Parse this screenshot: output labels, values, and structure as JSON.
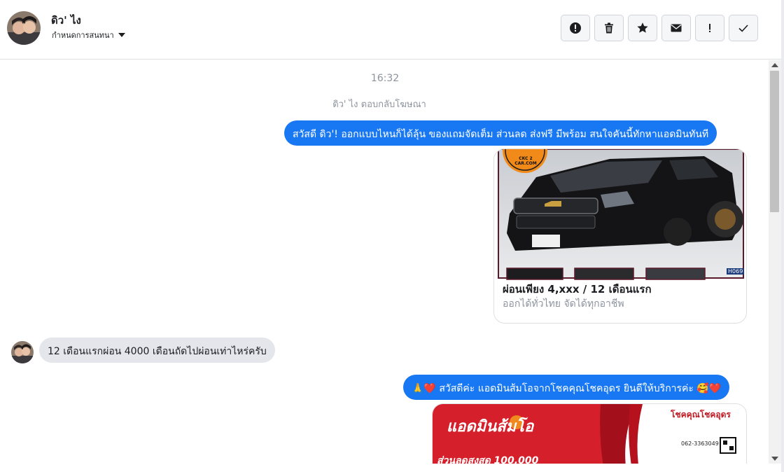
{
  "header": {
    "contact_name": "ดิว' ไง",
    "assign_label": "กำหนดการสนทนา"
  },
  "toolbar": {
    "buttons": [
      {
        "name": "spam-icon",
        "label": "report"
      },
      {
        "name": "trash-icon",
        "label": "delete"
      },
      {
        "name": "star-icon",
        "label": "star"
      },
      {
        "name": "envelope-icon",
        "label": "unread"
      },
      {
        "name": "exclamation-icon",
        "label": "follow-up"
      },
      {
        "name": "check-icon",
        "label": "done"
      }
    ]
  },
  "conversation": {
    "timestamp": "16:32",
    "ad_reply_note": "ดิว' ไง ตอบกลับโฆษณา",
    "msg_out_1": "สวัสดี ดิว'! ออกแบบไหนก็ได้ลุ้น ของแถมจัดเต็ม ส่วนลด ส่งฟรี มีพร้อม สนใจคันนี้ทักหาแอดมินทันที",
    "card_1": {
      "logo_text": "CKC 2 CAR.COM",
      "title": "ผ่อนเพียง 4,xxx / 12 เดือนแรก",
      "subtitle": "ออกได้ทั่วไทย จัดได้ทุกอาชีพ",
      "code": "H069"
    },
    "msg_in_1": "12 เดือนแรกผ่อน 4000 เดือนถัดไปผ่อนเท่าไหร่ครับ",
    "msg_out_2": "🙏❤️ สวัสดีค่ะ แอดมินส้มโอจากโชคคุณโชคอุดร ยินดีให้บริการค่ะ  🥰❤️",
    "card_2": {
      "banner_text": "แอดมินส้มโอ",
      "brand": "โชคคุณโชคอุดร",
      "phone": "062-3363049",
      "discount": "ส่วนลดสูงสุด 100,000"
    }
  },
  "colors": {
    "outgoing_bubble": "#1877f2",
    "incoming_bubble": "#e4e6eb",
    "muted_text": "#8d949e"
  }
}
